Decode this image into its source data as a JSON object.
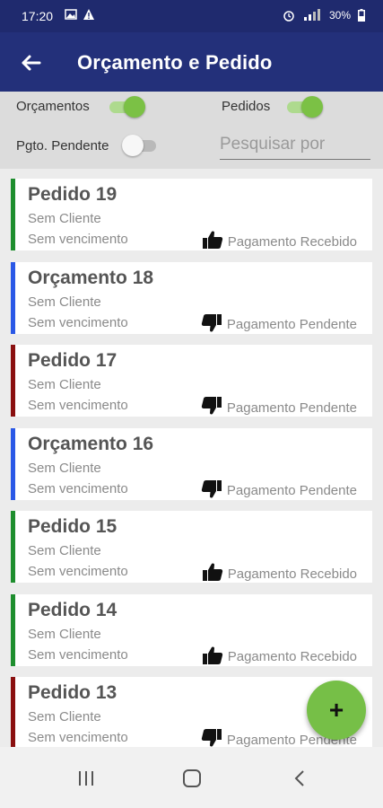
{
  "status_bar": {
    "time": "17:20",
    "battery": "30%"
  },
  "app_bar": {
    "title": "Orçamento e Pedido"
  },
  "filters": {
    "orcamentos_label": "Orçamentos",
    "orcamentos_on": true,
    "pedidos_label": "Pedidos",
    "pedidos_on": true,
    "pgto_pendente_label": "Pgto. Pendente",
    "pgto_pendente_on": false,
    "search_placeholder": "Pesquisar por"
  },
  "cards": [
    {
      "title": "Pedido 19",
      "client": "Sem Cliente",
      "due": "Sem vencimento",
      "payment": "Pagamento Recebido",
      "payment_icon": "thumbs-up-icon",
      "accent": "#1e8e2e"
    },
    {
      "title": "Orçamento 18",
      "client": "Sem Cliente",
      "due": "Sem vencimento",
      "payment": "Pagamento Pendente",
      "payment_icon": "thumbs-down-icon",
      "accent": "#2a58e6"
    },
    {
      "title": "Pedido 17",
      "client": "Sem Cliente",
      "due": "Sem vencimento",
      "payment": "Pagamento Pendente",
      "payment_icon": "thumbs-down-icon",
      "accent": "#8a1010"
    },
    {
      "title": "Orçamento 16",
      "client": "Sem Cliente",
      "due": "Sem vencimento",
      "payment": "Pagamento Pendente",
      "payment_icon": "thumbs-down-icon",
      "accent": "#2a58e6"
    },
    {
      "title": "Pedido 15",
      "client": "Sem Cliente",
      "due": "Sem vencimento",
      "payment": "Pagamento Recebido",
      "payment_icon": "thumbs-up-icon",
      "accent": "#1e8e2e"
    },
    {
      "title": "Pedido 14",
      "client": "Sem Cliente",
      "due": "Sem vencimento",
      "payment": "Pagamento Recebido",
      "payment_icon": "thumbs-up-icon",
      "accent": "#1e8e2e"
    },
    {
      "title": "Pedido 13",
      "client": "Sem Cliente",
      "due": "Sem vencimento",
      "payment": "Pagamento Pendente",
      "payment_icon": "thumbs-down-icon",
      "accent": "#8a1010"
    }
  ],
  "fab": {
    "label": "+",
    "icon": "plus-icon"
  },
  "nav_bar": {
    "icons": [
      "recent-apps-icon",
      "home-icon",
      "back-icon"
    ]
  },
  "colors": {
    "primary": "#23307a",
    "status_bar": "#1f2a6e",
    "accent_green": "#76bf47",
    "received": "#1e8e2e",
    "budget": "#2a58e6",
    "pending": "#8a1010"
  }
}
